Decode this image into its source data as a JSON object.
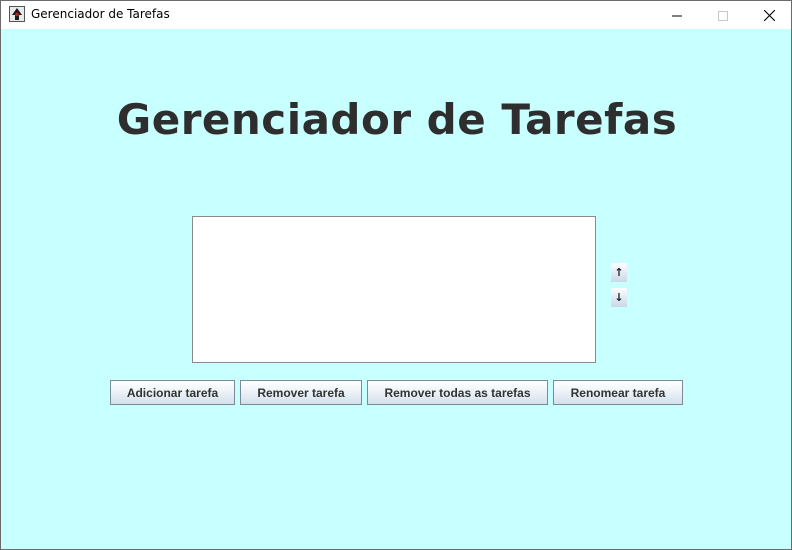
{
  "window": {
    "title": "Gerenciador de Tarefas",
    "icon": "java-duke-icon",
    "controls": [
      "minimize-icon",
      "maximize-icon",
      "close-icon"
    ]
  },
  "main": {
    "heading": "Gerenciador de Tarefas",
    "background_color": "#c8ffff",
    "task_list": {
      "items": []
    },
    "move_up_label": "↑",
    "move_down_label": "↓"
  },
  "buttons": {
    "add": "Adicionar tarefa",
    "remove": "Remover tarefa",
    "remove_all": "Remover todas as tarefas",
    "rename": "Renomear tarefa"
  }
}
